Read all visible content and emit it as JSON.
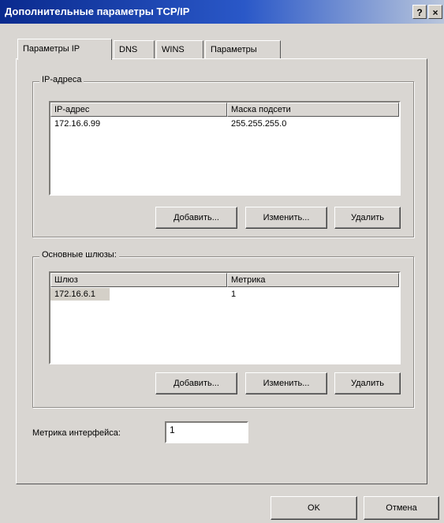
{
  "window": {
    "title": "Дополнительные параметры TCP/IP",
    "help_button": "?",
    "close_button": "×"
  },
  "tabs": [
    {
      "label": "Параметры IP",
      "active": true
    },
    {
      "label": "DNS",
      "active": false
    },
    {
      "label": "WINS",
      "active": false
    },
    {
      "label": "Параметры",
      "active": false
    }
  ],
  "ip_group": {
    "label": "IP-адреса",
    "columns": [
      "IP-адрес",
      "Маска подсети"
    ],
    "rows": [
      {
        "ip": "172.16.6.99",
        "mask": "255.255.255.0"
      }
    ],
    "add_button": "Добавить...",
    "edit_button": "Изменить...",
    "delete_button": "Удалить"
  },
  "gateway_group": {
    "label": "Основные шлюзы:",
    "columns": [
      "Шлюз",
      "Метрика"
    ],
    "rows": [
      {
        "gateway": "172.16.6.1",
        "metric": "1"
      }
    ],
    "add_button": "Добавить...",
    "edit_button": "Изменить...",
    "delete_button": "Удалить"
  },
  "interface_metric": {
    "label": "Метрика интерфейса:",
    "value": "1"
  },
  "footer": {
    "ok_button": "OK",
    "cancel_button": "Отмена"
  }
}
